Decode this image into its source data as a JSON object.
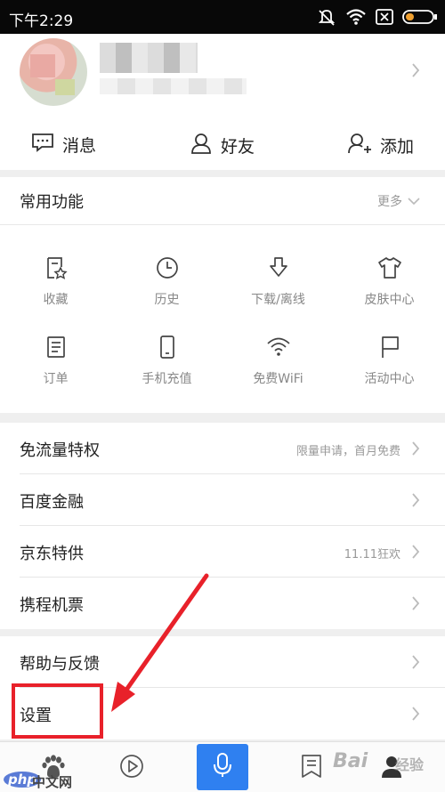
{
  "status_bar": {
    "time": "下午2:29",
    "icons": [
      "mute-icon",
      "wifi-icon",
      "sim-icon",
      "battery-icon"
    ]
  },
  "profile": {
    "avatar": "avatar",
    "name_blurred": true
  },
  "quick_actions": [
    {
      "label": "消息",
      "icon": "message-icon"
    },
    {
      "label": "好友",
      "icon": "friend-icon"
    },
    {
      "label": "添加",
      "icon": "add-friend-icon"
    }
  ],
  "common_functions": {
    "title": "常用功能",
    "more_label": "更多",
    "items": [
      {
        "label": "收藏",
        "icon": "favorite-icon"
      },
      {
        "label": "历史",
        "icon": "history-icon"
      },
      {
        "label": "下载/离线",
        "icon": "download-icon"
      },
      {
        "label": "皮肤中心",
        "icon": "skin-icon"
      },
      {
        "label": "订单",
        "icon": "order-icon"
      },
      {
        "label": "手机充值",
        "icon": "phone-icon"
      },
      {
        "label": "免费WiFi",
        "icon": "wifi-icon"
      },
      {
        "label": "活动中心",
        "icon": "flag-icon"
      }
    ]
  },
  "menu_group_1": [
    {
      "label": "免流量特权",
      "hint": "限量申请，首月免费"
    },
    {
      "label": "百度金融",
      "hint": ""
    },
    {
      "label": "京东特供",
      "hint": "11.11狂欢"
    },
    {
      "label": "携程机票",
      "hint": ""
    }
  ],
  "menu_group_2": [
    {
      "label": "帮助与反馈",
      "hint": ""
    },
    {
      "label": "设置",
      "hint": ""
    }
  ],
  "tab_bar": {
    "tabs": [
      "home-tab",
      "video-tab",
      "voice-tab",
      "news-tab",
      "profile-tab"
    ],
    "accent": "#2f80f0"
  },
  "annotation": {
    "highlight_color": "#e8212a"
  },
  "watermarks": {
    "php_left": "php",
    "php_right": "中文网",
    "baidu": "Bai",
    "baidu_tail": "经验"
  }
}
